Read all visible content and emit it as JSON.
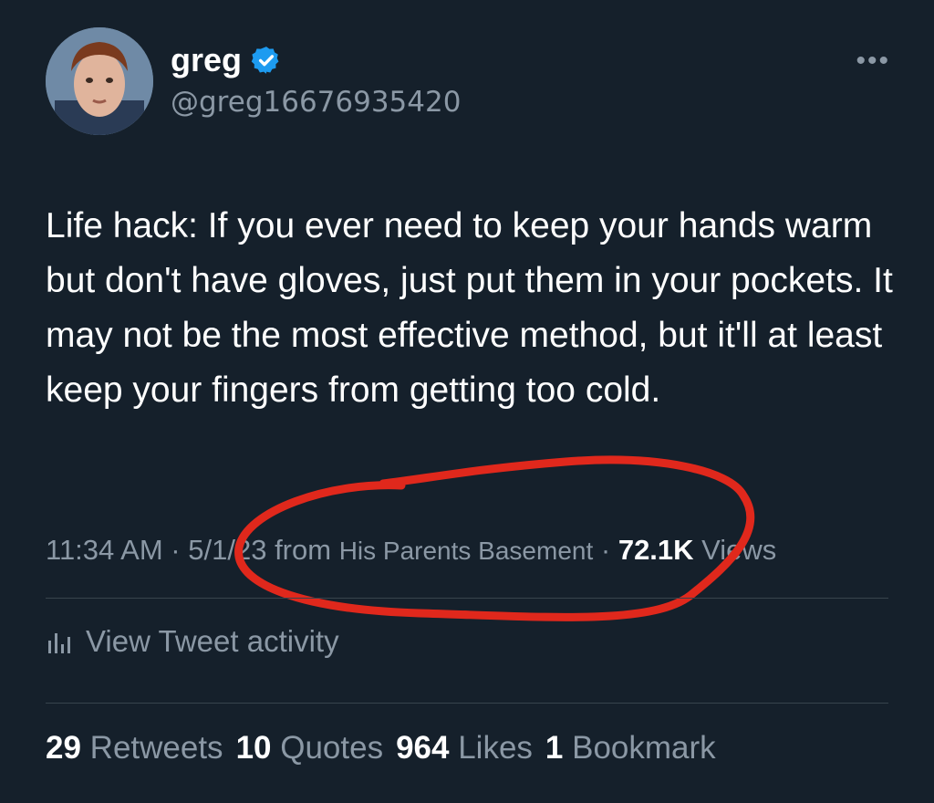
{
  "author": {
    "name": "greg",
    "handle": "@greg16676935420",
    "verified": true
  },
  "menu": {
    "more_label": "•••"
  },
  "tweet": {
    "text": "Life hack: If you ever need to keep your hands warm but don't have gloves, just put them in your pockets. It may not be the most effective method, but it'll at least keep your fingers from getting too cold."
  },
  "meta": {
    "time": "11:34 AM",
    "sep1": " · ",
    "date": "5/1/23",
    "from_label": " from ",
    "source": "His Parents Basement",
    "sep2": " · ",
    "views_count": "72.1K",
    "views_label": " Views"
  },
  "activity": {
    "label": "View Tweet activity"
  },
  "stats": {
    "retweets_count": "29",
    "retweets_label": " Retweets",
    "quotes_count": "10",
    "quotes_label": " Quotes",
    "likes_count": "964",
    "likes_label": " Likes",
    "bookmarks_count": "1",
    "bookmarks_label": " Bookmark"
  },
  "colors": {
    "background": "#15202b",
    "text_primary": "#ffffff",
    "text_secondary": "#8b98a5",
    "verified_blue": "#1d9bf0",
    "annotation_red": "#e0281c",
    "divider": "#38444d"
  }
}
